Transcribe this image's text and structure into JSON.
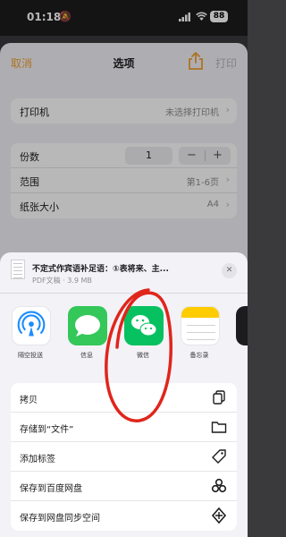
{
  "status_bar": {
    "time": "01:18",
    "battery": "88"
  },
  "options": {
    "nav": {
      "cancel": "取消",
      "title": "选项",
      "print": "打印"
    },
    "printer": {
      "label": "打印机",
      "value": "未选择打印机"
    },
    "copies": {
      "label": "份数",
      "value": "1",
      "minus": "−",
      "plus": "+"
    },
    "range": {
      "label": "范围",
      "value": "第1-6页"
    },
    "paper_size": {
      "label": "纸张大小",
      "value": "A4"
    }
  },
  "share_sheet": {
    "doc_title": "不定式作宾语补足语：①表将来、主...",
    "doc_meta": "PDF文稿 · 3.9 MB",
    "close": "✕",
    "apps": [
      {
        "name": "airdrop",
        "label": "隔空投送"
      },
      {
        "name": "messages",
        "label": "信息"
      },
      {
        "name": "wechat",
        "label": "微信"
      },
      {
        "name": "notes",
        "label": "备忘录"
      }
    ],
    "actions": [
      {
        "label": "拷贝",
        "icon": "copy-icon"
      },
      {
        "label": "存储到“文件”",
        "icon": "folder-icon"
      },
      {
        "label": "添加标签",
        "icon": "tag-icon"
      },
      {
        "label": "保存到百度网盘",
        "icon": "baidu-netdisk-icon"
      },
      {
        "label": "保存到网盘同步空间",
        "icon": "sync-space-icon"
      }
    ]
  },
  "colors": {
    "accent": "#f0a030",
    "wechat": "#07c160",
    "messages": "#34c759",
    "annotation": "#e0251b"
  }
}
